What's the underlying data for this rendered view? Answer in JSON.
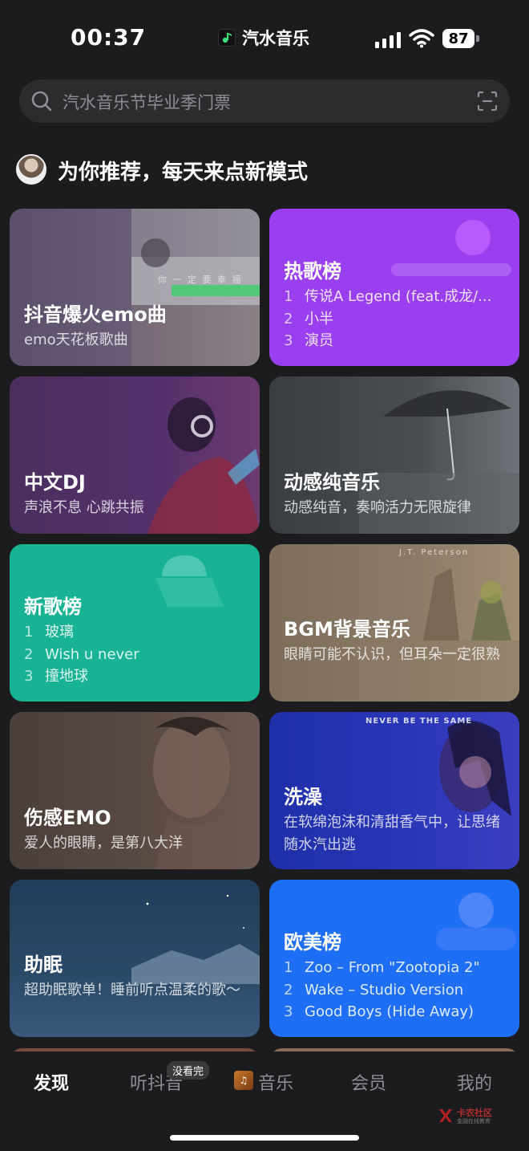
{
  "status_bar": {
    "time": "00:37",
    "app_name": "汽水音乐",
    "battery": "87"
  },
  "search": {
    "placeholder": "汽水音乐节毕业季门票"
  },
  "recommend": {
    "title": "为你推荐，每天来点新模式"
  },
  "cards": [
    {
      "title": "抖音爆火emo曲",
      "subtitle": "emo天花板歌曲",
      "art_text": "你 一 定 要 幸 福"
    },
    {
      "title": "热歌榜",
      "ranks": [
        {
          "n": "1",
          "song": "传说A Legend (feat.成龙/..."
        },
        {
          "n": "2",
          "song": "小半"
        },
        {
          "n": "3",
          "song": "演员"
        }
      ]
    },
    {
      "title": "中文DJ",
      "subtitle": "声浪不息 心跳共振"
    },
    {
      "title": "动感纯音乐",
      "subtitle": "动感纯音，奏响活力无限旋律"
    },
    {
      "title": "新歌榜",
      "ranks": [
        {
          "n": "1",
          "song": "玻璃"
        },
        {
          "n": "2",
          "song": "Wish u never"
        },
        {
          "n": "3",
          "song": "撞地球"
        }
      ]
    },
    {
      "title": "BGM背景音乐",
      "subtitle": "眼睛可能不认识，但耳朵一定很熟",
      "art_text": "J.T. Peterson"
    },
    {
      "title": "伤感EMO",
      "subtitle": "爱人的眼睛，是第八大洋"
    },
    {
      "title": "洗澡",
      "subtitle": "在软绵泡沫和清甜香气中，让思绪随水汽出逃",
      "art_text": "NEVER BE THE SAME"
    },
    {
      "title": "助眠",
      "subtitle": "超助眠歌单！睡前听点温柔的歌～"
    },
    {
      "title": "欧美榜",
      "ranks": [
        {
          "n": "1",
          "song": "Zoo – From \"Zootopia 2\""
        },
        {
          "n": "2",
          "song": "Wake – Studio Version"
        },
        {
          "n": "3",
          "song": "Good Boys (Hide Away)"
        }
      ]
    }
  ],
  "tabs": [
    {
      "label": "发现",
      "active": true
    },
    {
      "label": "听抖音",
      "badge": "没看完"
    },
    {
      "label": "音乐"
    },
    {
      "label": "会员"
    },
    {
      "label": "我的"
    }
  ],
  "icons": {
    "search": "search-icon",
    "scan": "scan-icon",
    "wifi": "wifi-icon",
    "signal": "signal-icon"
  },
  "colors": {
    "background": "#1c1c1e",
    "hot_chart": "#9a3ff0",
    "new_chart": "#17b394",
    "western_chart": "#1e6ff5"
  },
  "watermark": {
    "title": "卡农社区",
    "subtitle": "金融在线教育"
  }
}
